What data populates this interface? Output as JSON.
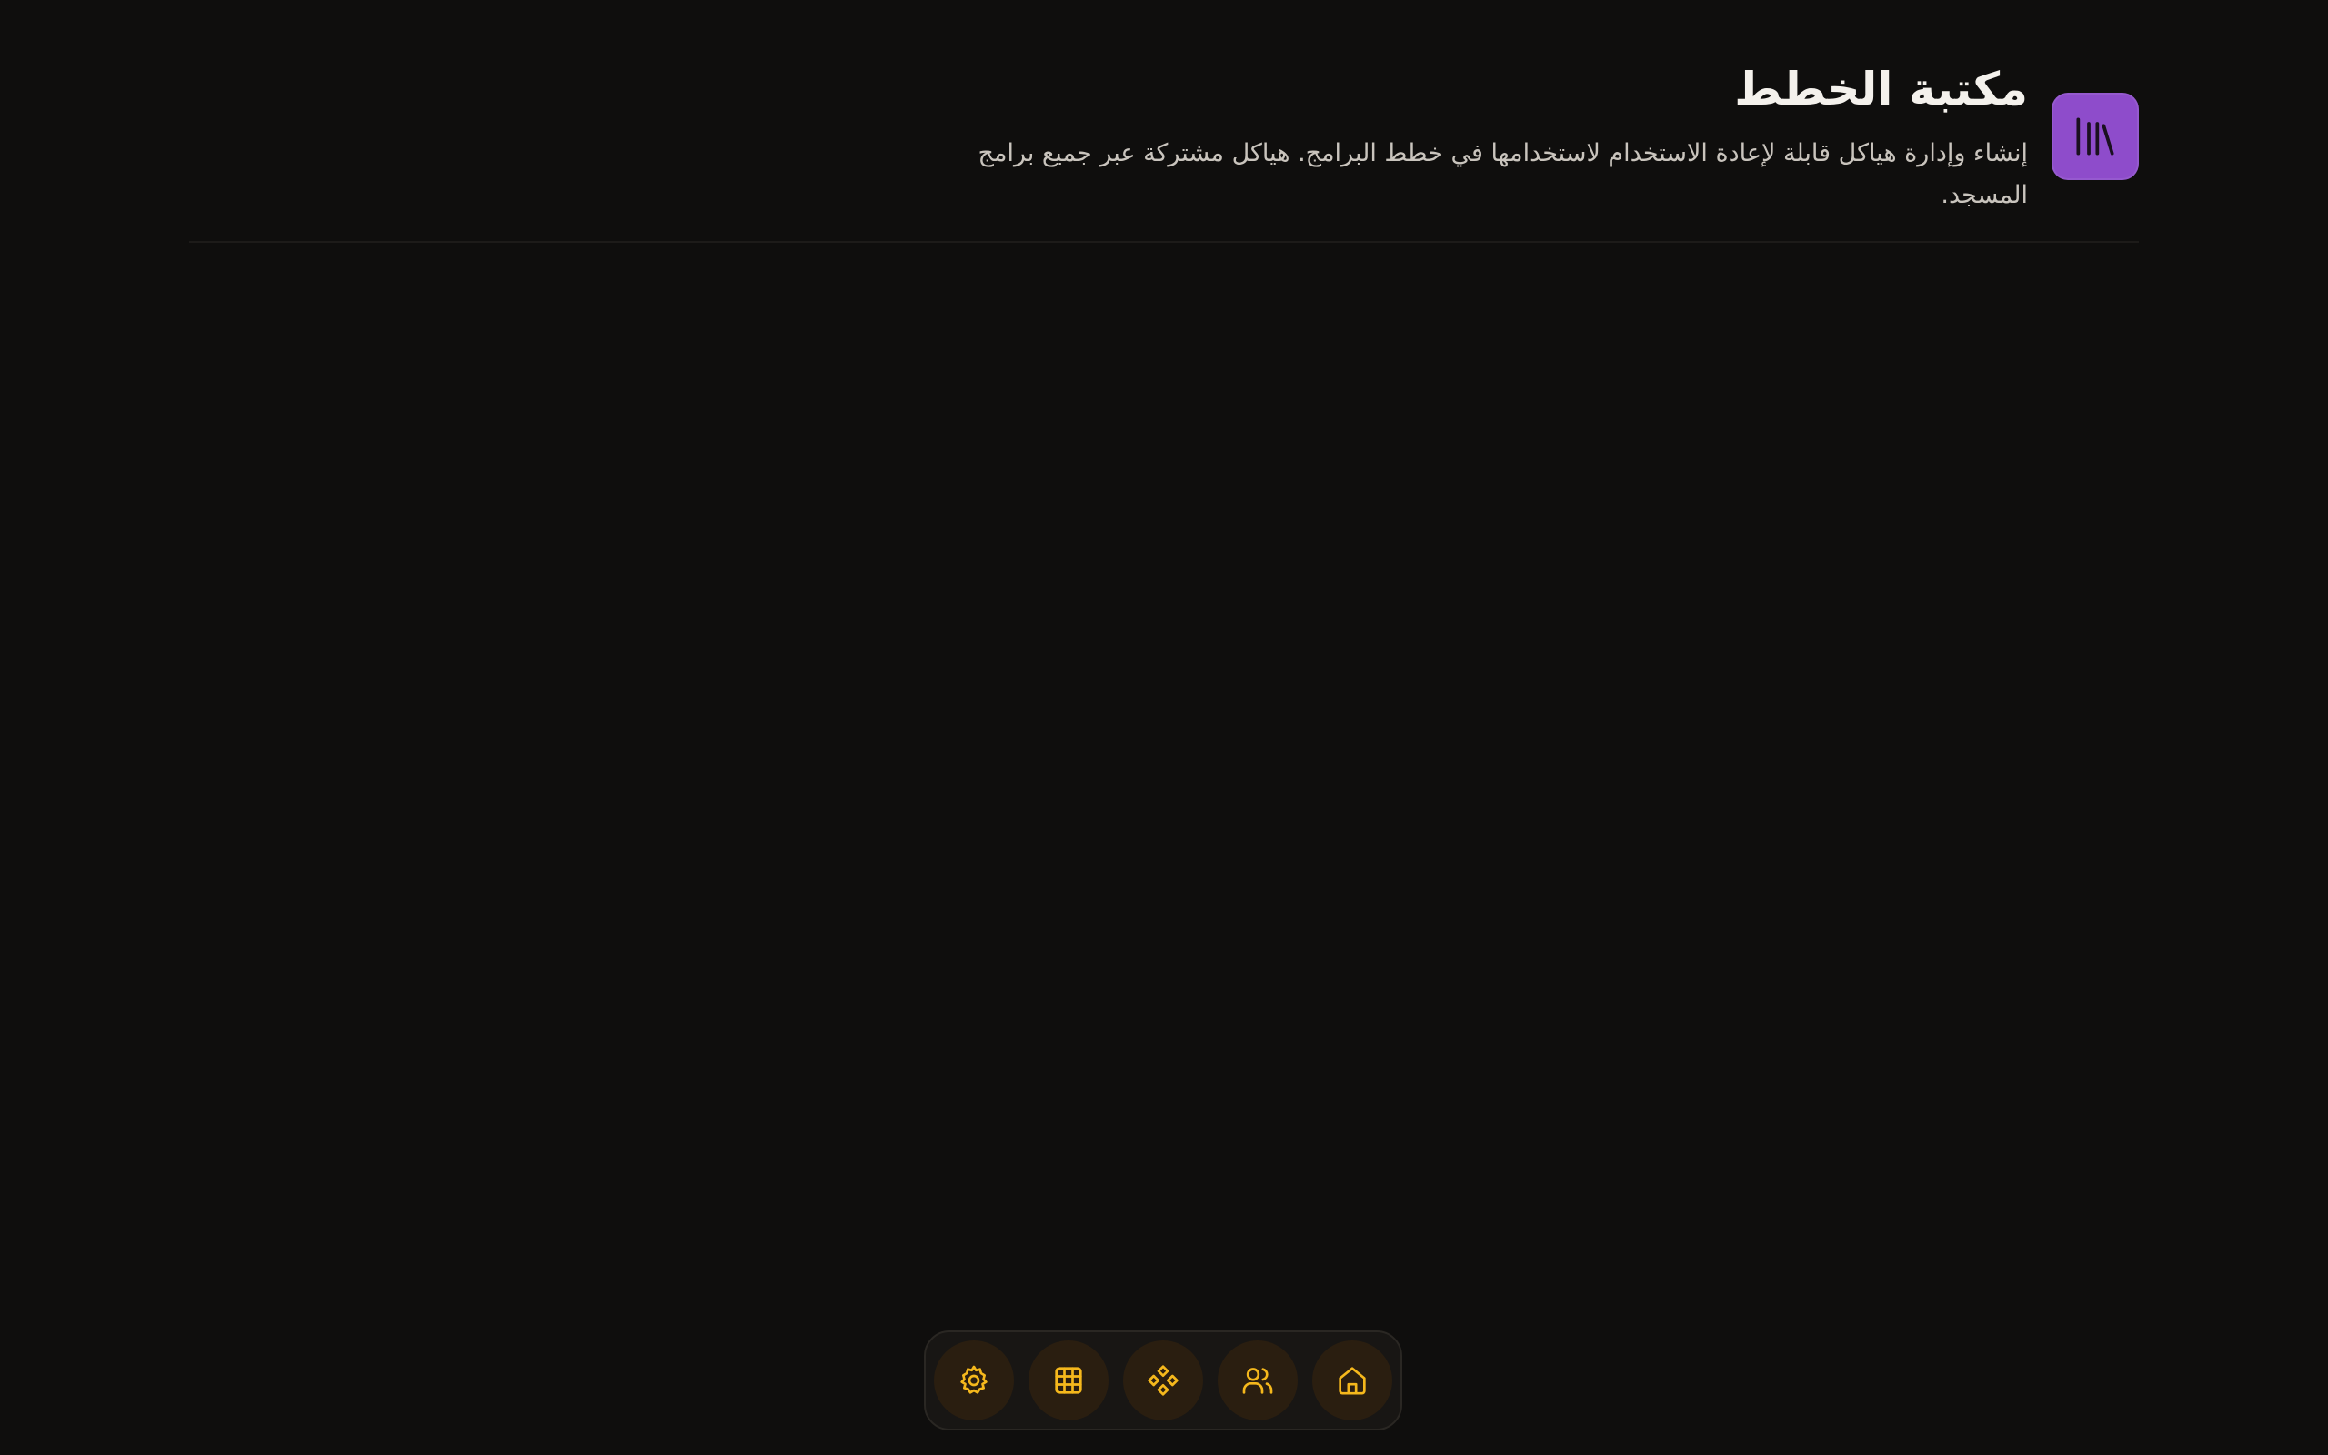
{
  "header": {
    "title": "مكتبة الخطط",
    "subtitle": "إنشاء وإدارة هياكل قابلة لإعادة الاستخدام لاستخدامها في خطط البرامج. هياكل مشتركة عبر جميع برامج المسجد.",
    "icon": "library-icon"
  },
  "dock": {
    "items": [
      {
        "icon": "settings-icon"
      },
      {
        "icon": "grid-icon"
      },
      {
        "icon": "components-icon"
      },
      {
        "icon": "users-icon"
      },
      {
        "icon": "home-icon"
      }
    ]
  },
  "colors": {
    "background": "#0f0e0d",
    "accent_purple": "#8e4ccb",
    "dock_icon": "#f5b81c",
    "title_text": "#f4f1ec",
    "subtitle_text": "#c9c4bd"
  }
}
